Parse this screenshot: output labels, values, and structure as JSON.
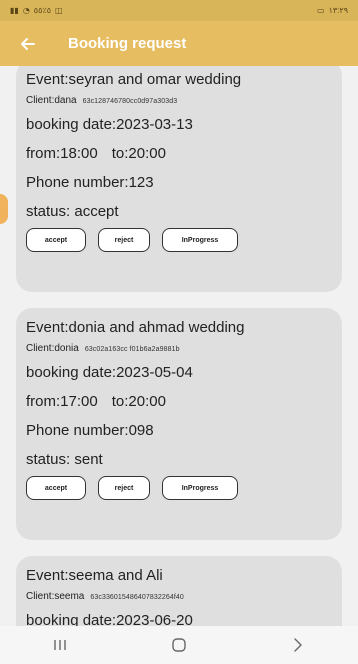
{
  "status_bar": {
    "left_text": "٥٪٥٥",
    "time": "١٣:٢٩",
    "left_icons": [
      "signal-icon",
      "wifi-icon",
      "notification-icon"
    ],
    "right_icons": [
      "battery-icon"
    ]
  },
  "app_bar": {
    "title": "Booking request",
    "back_icon": "arrow-left-icon",
    "color": "#e6bd61"
  },
  "bookings": [
    {
      "event": "Event:seyran and omar wedding",
      "client": "Client:dana",
      "client_id": "63c128746780cc0d97a303d3",
      "date": "booking date:2023-03-13",
      "from": "from:18:00",
      "to": "to:20:00",
      "phone": "Phone number:123",
      "status": "status: accept"
    },
    {
      "event": "Event:donia and ahmad wedding",
      "client": "Client:donia",
      "client_id": "63c02a163cc f01b6a2a9881b",
      "date": "booking date:2023-05-04",
      "from": "from:17:00",
      "to": "to:20:00",
      "phone": "Phone number:098",
      "status": "status: sent"
    },
    {
      "event": "Event:seema and Ali",
      "client": "Client:seema",
      "client_id": "63c336015486407832264f40",
      "date": "booking date:2023-06-20"
    }
  ],
  "actions": {
    "accept": "accept",
    "reject": "reject",
    "in_progress": "InProgress"
  },
  "nav": {
    "recent_icon": "recent-apps-icon",
    "home_icon": "home-icon",
    "back_icon": "chevron-right-icon"
  }
}
